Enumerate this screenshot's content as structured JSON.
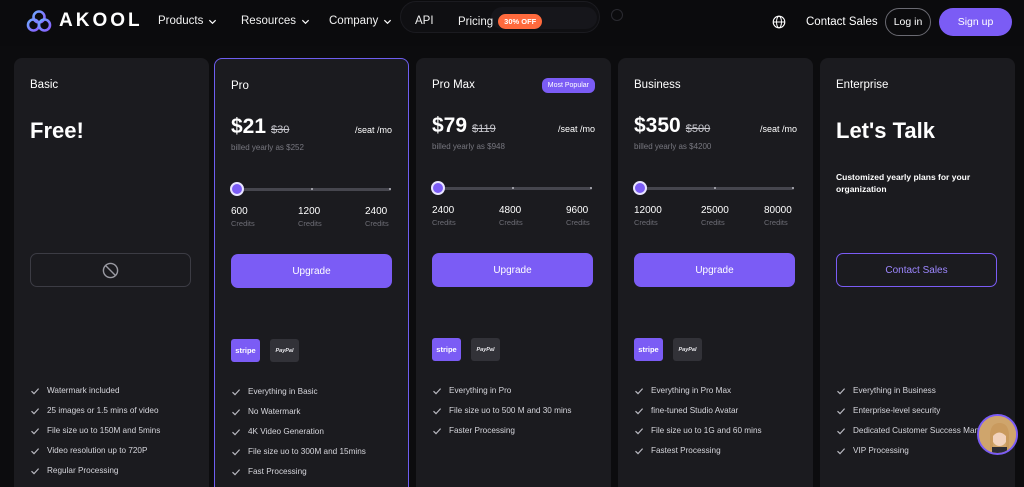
{
  "nav": {
    "logo_text": "AKOOL",
    "items": {
      "products": "Products",
      "resources": "Resources",
      "company": "Company",
      "api": "API",
      "pricing": "Pricing"
    },
    "pricing_badge": "30% OFF",
    "contact_sales": "Contact Sales",
    "login": "Log in",
    "signup": "Sign up"
  },
  "plans": {
    "basic": {
      "name": "Basic",
      "headline": "Free!",
      "features": [
        "Watermark included",
        "25 images or 1.5 mins of video",
        "File size uo to 150M and 5mins",
        "Video resolution up to 720P",
        "Regular Processing"
      ]
    },
    "pro": {
      "name": "Pro",
      "price": "$21",
      "old_price": "$30",
      "per": "/seat /mo",
      "billed": "billed yearly as $252",
      "slider_level": 0,
      "credits": [
        {
          "num": "600",
          "lbl": "Credits"
        },
        {
          "num": "1200",
          "lbl": "Credits"
        },
        {
          "num": "2400",
          "lbl": "Credits"
        }
      ],
      "button": "Upgrade",
      "features": [
        "Everything in Basic",
        "No Watermark",
        "4K Video Generation",
        "File size uo to 300M and 15mins",
        "Fast Processing"
      ]
    },
    "pro_max": {
      "name": "Pro Max",
      "badge": "Most Popular",
      "price": "$79",
      "old_price": "$119",
      "per": "/seat /mo",
      "billed": "billed yearly as $948",
      "slider_level": 0,
      "credits": [
        {
          "num": "2400",
          "lbl": "Credits"
        },
        {
          "num": "4800",
          "lbl": "Credits"
        },
        {
          "num": "9600",
          "lbl": "Credits"
        }
      ],
      "button": "Upgrade",
      "features": [
        "Everything in Pro",
        "File size uo to 500 M and 30 mins",
        "Faster Processing"
      ]
    },
    "business": {
      "name": "Business",
      "price": "$350",
      "old_price": "$500",
      "per": "/seat /mo",
      "billed": "billed yearly as $4200",
      "slider_level": 0,
      "credits": [
        {
          "num": "12000",
          "lbl": "Credits"
        },
        {
          "num": "25000",
          "lbl": "Credits"
        },
        {
          "num": "80000",
          "lbl": "Credits"
        }
      ],
      "button": "Upgrade",
      "features": [
        "Everything in Pro Max",
        "fine-tuned Studio Avatar",
        "File size uo to 1G and 60 mins",
        "Fastest  Processing"
      ]
    },
    "enterprise": {
      "name": "Enterprise",
      "headline": "Let's Talk",
      "desc": "Customized yearly plans for your organization",
      "button": "Contact Sales",
      "features": [
        "Everything in Business",
        "Enterprise-level security",
        "Dedicated Customer Success Manager",
        "VIP Processing"
      ]
    }
  },
  "payments": {
    "stripe": "stripe",
    "paypal": "PayPal"
  },
  "colors": {
    "accent": "#7b5cf5",
    "badge_orange": "#ff6a3d",
    "card_bg": "#1b1b1f",
    "page_bg": "#0c0c0e"
  },
  "icons": [
    "akool-logo-icon",
    "chevron-down-icon",
    "globe-icon",
    "ban-icon",
    "check-icon",
    "info-icon"
  ]
}
